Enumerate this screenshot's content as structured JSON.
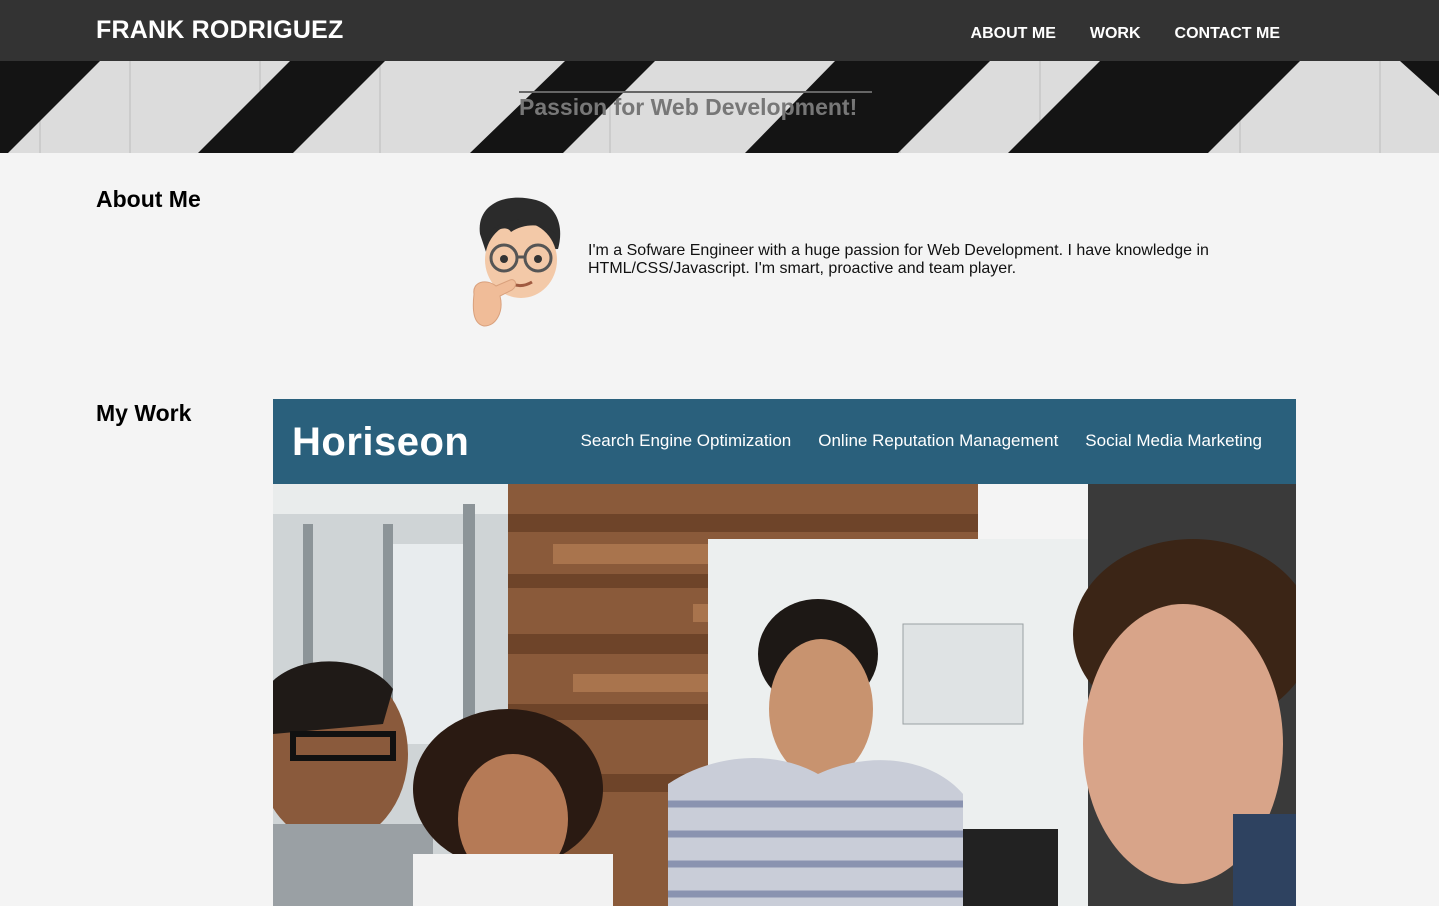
{
  "header": {
    "brand": "FRANK RODRIGUEZ",
    "nav": [
      "ABOUT ME",
      "WORK",
      "CONTACT ME"
    ]
  },
  "hero": {
    "title": "Passion for Web Development!"
  },
  "about": {
    "heading": "About Me",
    "avatar_icon": "memoji-thinking-avatar",
    "text": "I'm a Sofware Engineer with a huge passion for Web Development. I have knowledge in HTML/CSS/Javascript. I'm smart, proactive and team player."
  },
  "work": {
    "heading": "My Work",
    "project": {
      "logo": "Horiseon",
      "nav": [
        "Search Engine Optimization",
        "Online Reputation Management",
        "Social Media Marketing"
      ]
    }
  },
  "colors": {
    "topbar": "#333333",
    "page_bg": "#f4f4f4",
    "project_header": "#2a607c"
  }
}
